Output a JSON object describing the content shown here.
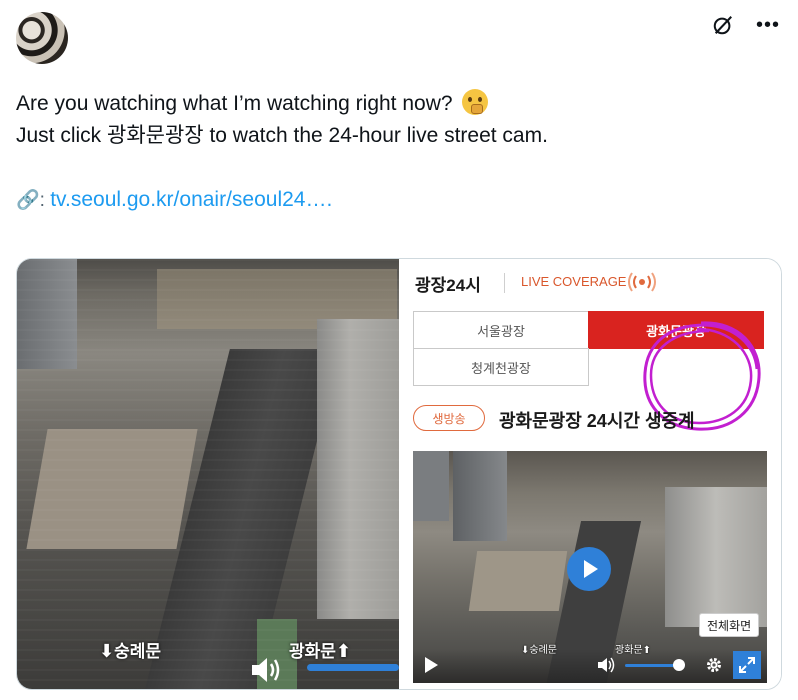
{
  "tweet": {
    "line1": "Are you watching what I’m watching right now?",
    "line2": "Just click 광화문광장 to watch the 24-hour live street cam.",
    "link_prefix": "🔗: ",
    "link_text": "tv.seoul.go.kr/onair/seoul24…."
  },
  "header_icons": [
    "grok-icon",
    "more-icon"
  ],
  "more_label": "•••",
  "left_video": {
    "label_left": "숭례문",
    "label_right": "광화문"
  },
  "right_panel": {
    "title": "광장24시",
    "live_coverage": "LIVE COVERAGE",
    "tabs": [
      "서울광장",
      "광화문광장",
      "청계천광장"
    ],
    "selected_tab": "광화문광장",
    "badge": "생방송",
    "heading": "광화문광장 24시간 생중계",
    "player": {
      "label_left": "숭례문",
      "label_right": "광화문",
      "fullscreen_tooltip": "전체화면",
      "volume": 0.9
    },
    "accent_color": "#d9231f",
    "player_color": "#2f80d8",
    "annotation_color": "#c21fd0"
  }
}
